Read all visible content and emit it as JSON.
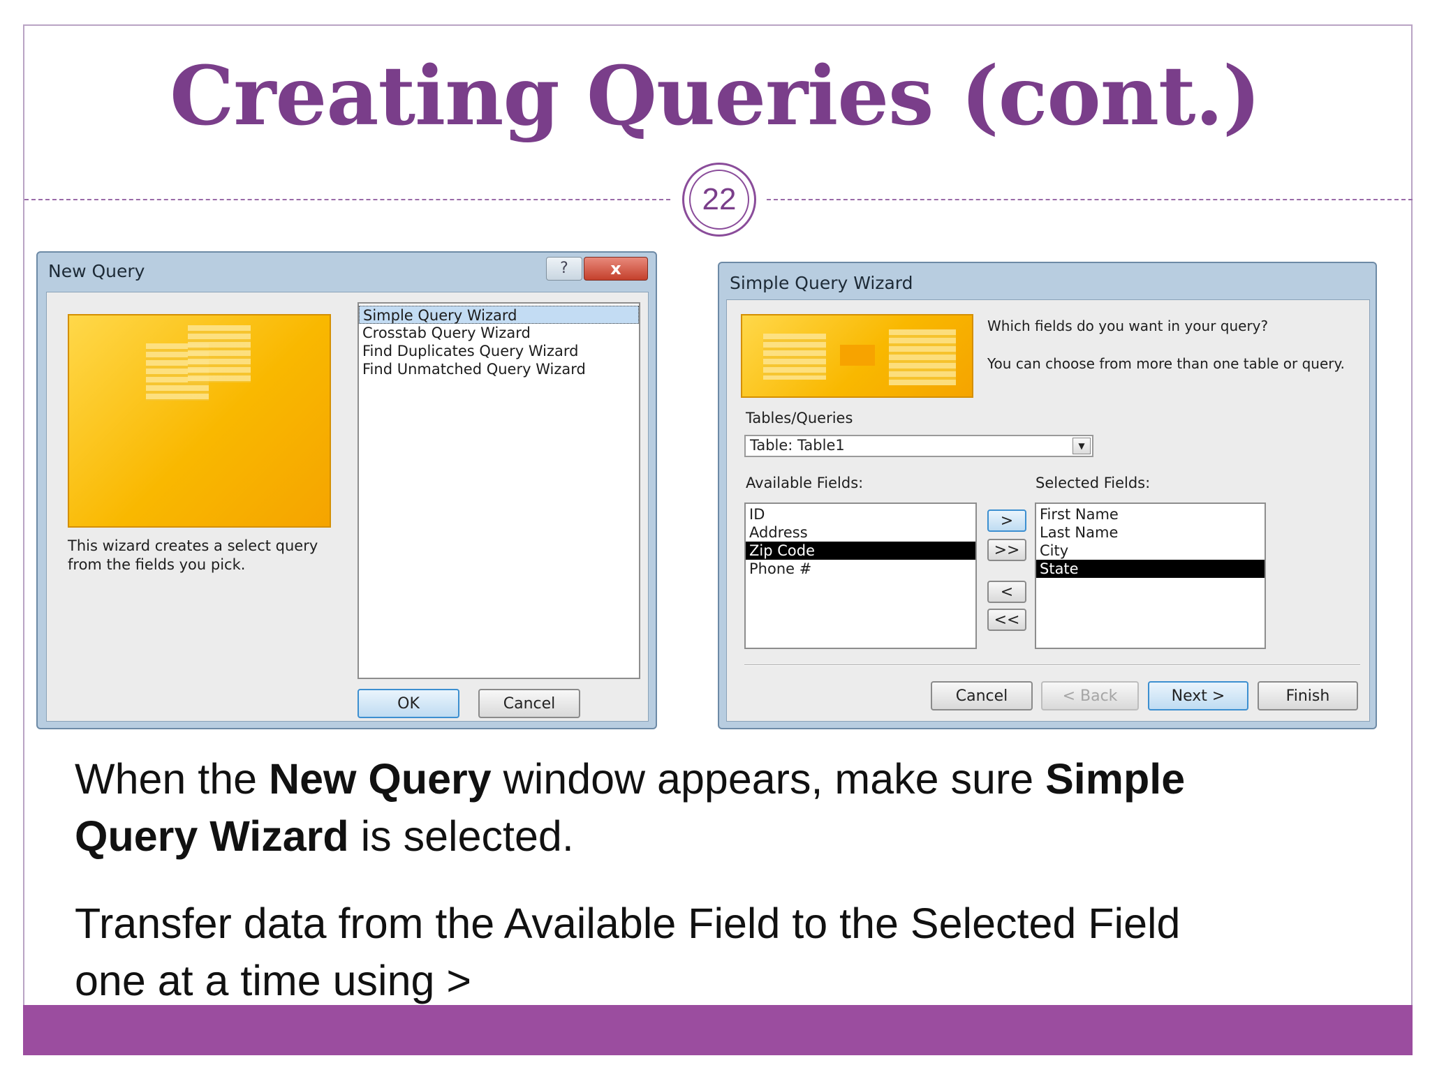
{
  "slide": {
    "title": "Creating Queries (cont.)",
    "page_number": "22",
    "colors": {
      "title": "#7a3e8a",
      "bottom_bar": "#9b4d9f",
      "selection": "#000000"
    }
  },
  "new_query_dialog": {
    "title": "New Query",
    "help_label": "?",
    "close_label": "x",
    "options": [
      "Simple Query Wizard",
      "Crosstab Query Wizard",
      "Find Duplicates Query Wizard",
      "Find Unmatched Query Wizard"
    ],
    "selected_option": "Simple Query Wizard",
    "description_line1": "This wizard creates a select query",
    "description_line2": "from the fields you pick.",
    "ok_label": "OK",
    "cancel_label": "Cancel"
  },
  "simple_query_wizard": {
    "title": "Simple Query Wizard",
    "prompt1": "Which fields do you want in your query?",
    "prompt2": "You can choose from more than one table or query.",
    "tables_label": "Tables/Queries",
    "tables_value": "Table: Table1",
    "available_label": "Available Fields:",
    "selected_label": "Selected Fields:",
    "available_fields": [
      "ID",
      "Address",
      "Zip Code",
      "Phone #"
    ],
    "available_selected": "Zip Code",
    "selected_fields": [
      "First Name",
      "Last Name",
      "City",
      "State"
    ],
    "selected_selected": "State",
    "move_one": ">",
    "move_all": ">>",
    "remove_one": "<",
    "remove_all": "<<",
    "cancel_label": "Cancel",
    "back_label": "< Back",
    "next_label": "Next >",
    "finish_label": "Finish"
  },
  "body": {
    "p1_a": "When the ",
    "p1_b": "New Query",
    "p1_c": " window appears, make sure ",
    "p1_d": "Simple",
    "p1_e": "Query Wizard",
    "p1_f": " is selected.",
    "p2_line1": "Transfer data from the Available Field to the Selected Field",
    "p2_line2": "one at a time using >"
  }
}
